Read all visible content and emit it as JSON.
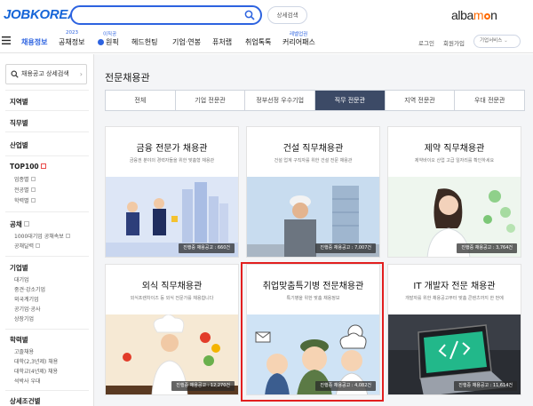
{
  "header": {
    "logo": "JOBKOREA",
    "search_placeholder": "",
    "detail_search_label": "상세검색",
    "albamon_a": "alba",
    "albamon_b": "m",
    "albamon_c": "n"
  },
  "nav": {
    "items": [
      {
        "label": "채용정보",
        "active": true
      },
      {
        "label": "공채정보",
        "badge": "2023"
      },
      {
        "label": "원픽",
        "badge": "이직공"
      },
      {
        "label": "헤드헌팅"
      },
      {
        "label": "기업·연봉"
      },
      {
        "label": "퓨처랩"
      },
      {
        "label": "취업톡톡"
      },
      {
        "label": "커리어패스",
        "badge": "레벨업권"
      }
    ],
    "login": "로그인",
    "join": "회원가입",
    "company_service": "기업서비스"
  },
  "sidebar": {
    "search_label": "채용공고 상세검색",
    "sections": [
      {
        "label": "지역별"
      },
      {
        "label": "직무별"
      },
      {
        "label": "산업별"
      },
      {
        "label": "TOP100",
        "subs": [
          "업종별",
          "전공별",
          "학력별"
        ]
      },
      {
        "label": "공채",
        "subs": [
          "1000대기업 공채속보",
          "공채달력"
        ]
      },
      {
        "label": "기업별",
        "subs": [
          "대기업",
          "중견·강소기업",
          "외국계기업",
          "공기업·공사",
          "상장기업"
        ]
      },
      {
        "label": "학력별",
        "subs": [
          "고졸채용",
          "대학(2,3년제) 채용",
          "대학교(4년제) 채용",
          "석박사 우대"
        ]
      },
      {
        "label": "상세조건별"
      }
    ]
  },
  "main": {
    "title": "전문채용관",
    "tabs": [
      "전체",
      "기업 전문관",
      "정부선정 우수기업",
      "직무 전문관",
      "지역 전문관",
      "우대 전문관"
    ],
    "active_tab": 3,
    "cards": [
      {
        "title": "금융 전문가 채용관",
        "desc": "금융권 분야의 경력자들을 위한 맞춤형 채용관",
        "count": "진행중 채용공고 : 660건",
        "theme": "finance"
      },
      {
        "title": "건설 직무채용관",
        "desc": "건설 업계 구직자를 위한 건설 전문 채용관",
        "count": "진행중 채용공고 : 7,007건",
        "theme": "construction"
      },
      {
        "title": "제약 직무채용관",
        "desc": "제약바이오 산업 고급 일자리를 확인하세요",
        "count": "진행중 채용공고 : 3,764건",
        "theme": "pharma"
      },
      {
        "title": "외식 직무채용관",
        "desc": "외식프랜차이즈 등 외식 전문가를 채용합니다",
        "count": "진행중 채용공고 : 12,270건",
        "theme": "food"
      },
      {
        "title": "취업맞춤특기병 전문채용관",
        "desc": "특기병을 위한 맞춤 채용정보",
        "count": "진행중 채용공고 : 4,082건",
        "theme": "military"
      },
      {
        "title": "IT 개발자 전문 채용관",
        "desc": "개발자를 위한 채용공고부터 맞춤 콘텐츠까지 한 번에",
        "count": "진행중 채용공고 : 11,614건",
        "theme": "it"
      }
    ]
  },
  "colors": {
    "brand": "#1565d8",
    "accent": "#2d63e0",
    "active_tab": "#3c4a66",
    "highlight": "#e21f1f",
    "albamon_orange": "#ff6a00"
  }
}
